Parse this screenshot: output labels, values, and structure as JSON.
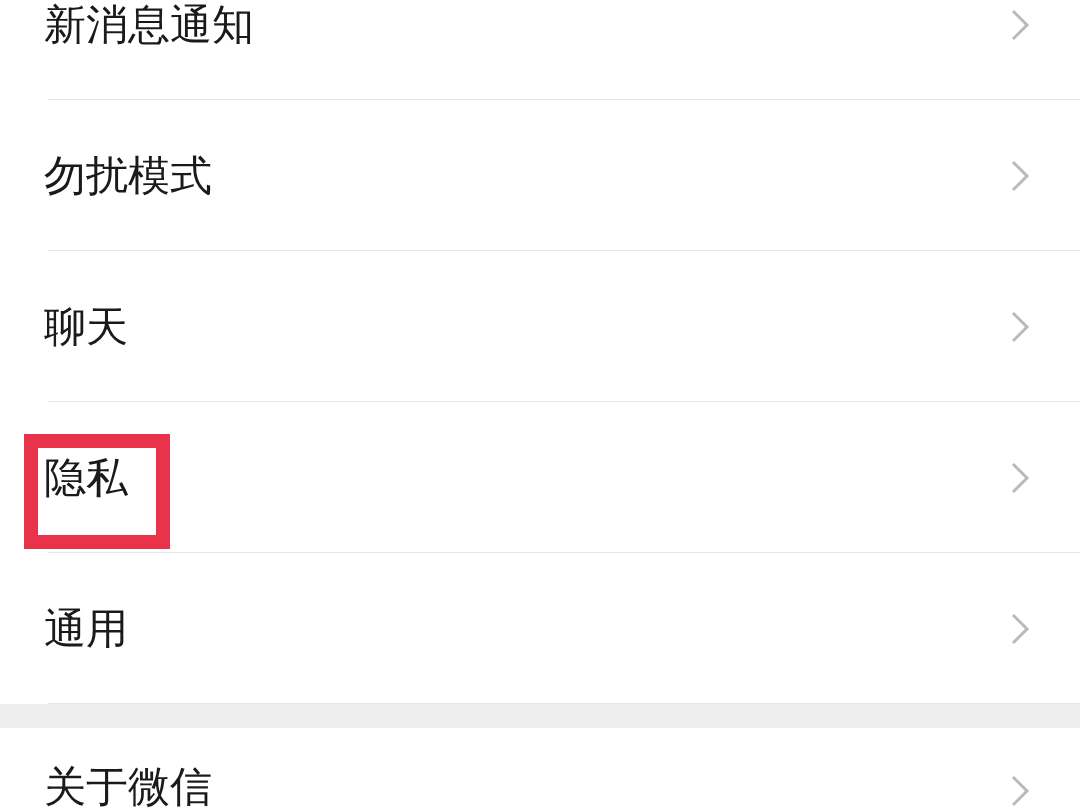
{
  "sections": [
    {
      "items": [
        {
          "label": "新消息通知",
          "highlighted": false
        },
        {
          "label": "勿扰模式",
          "highlighted": false
        },
        {
          "label": "聊天",
          "highlighted": false
        },
        {
          "label": "隐私",
          "highlighted": true
        },
        {
          "label": "通用",
          "highlighted": false
        }
      ]
    },
    {
      "items": [
        {
          "label": "关于微信",
          "highlighted": false
        }
      ]
    }
  ]
}
